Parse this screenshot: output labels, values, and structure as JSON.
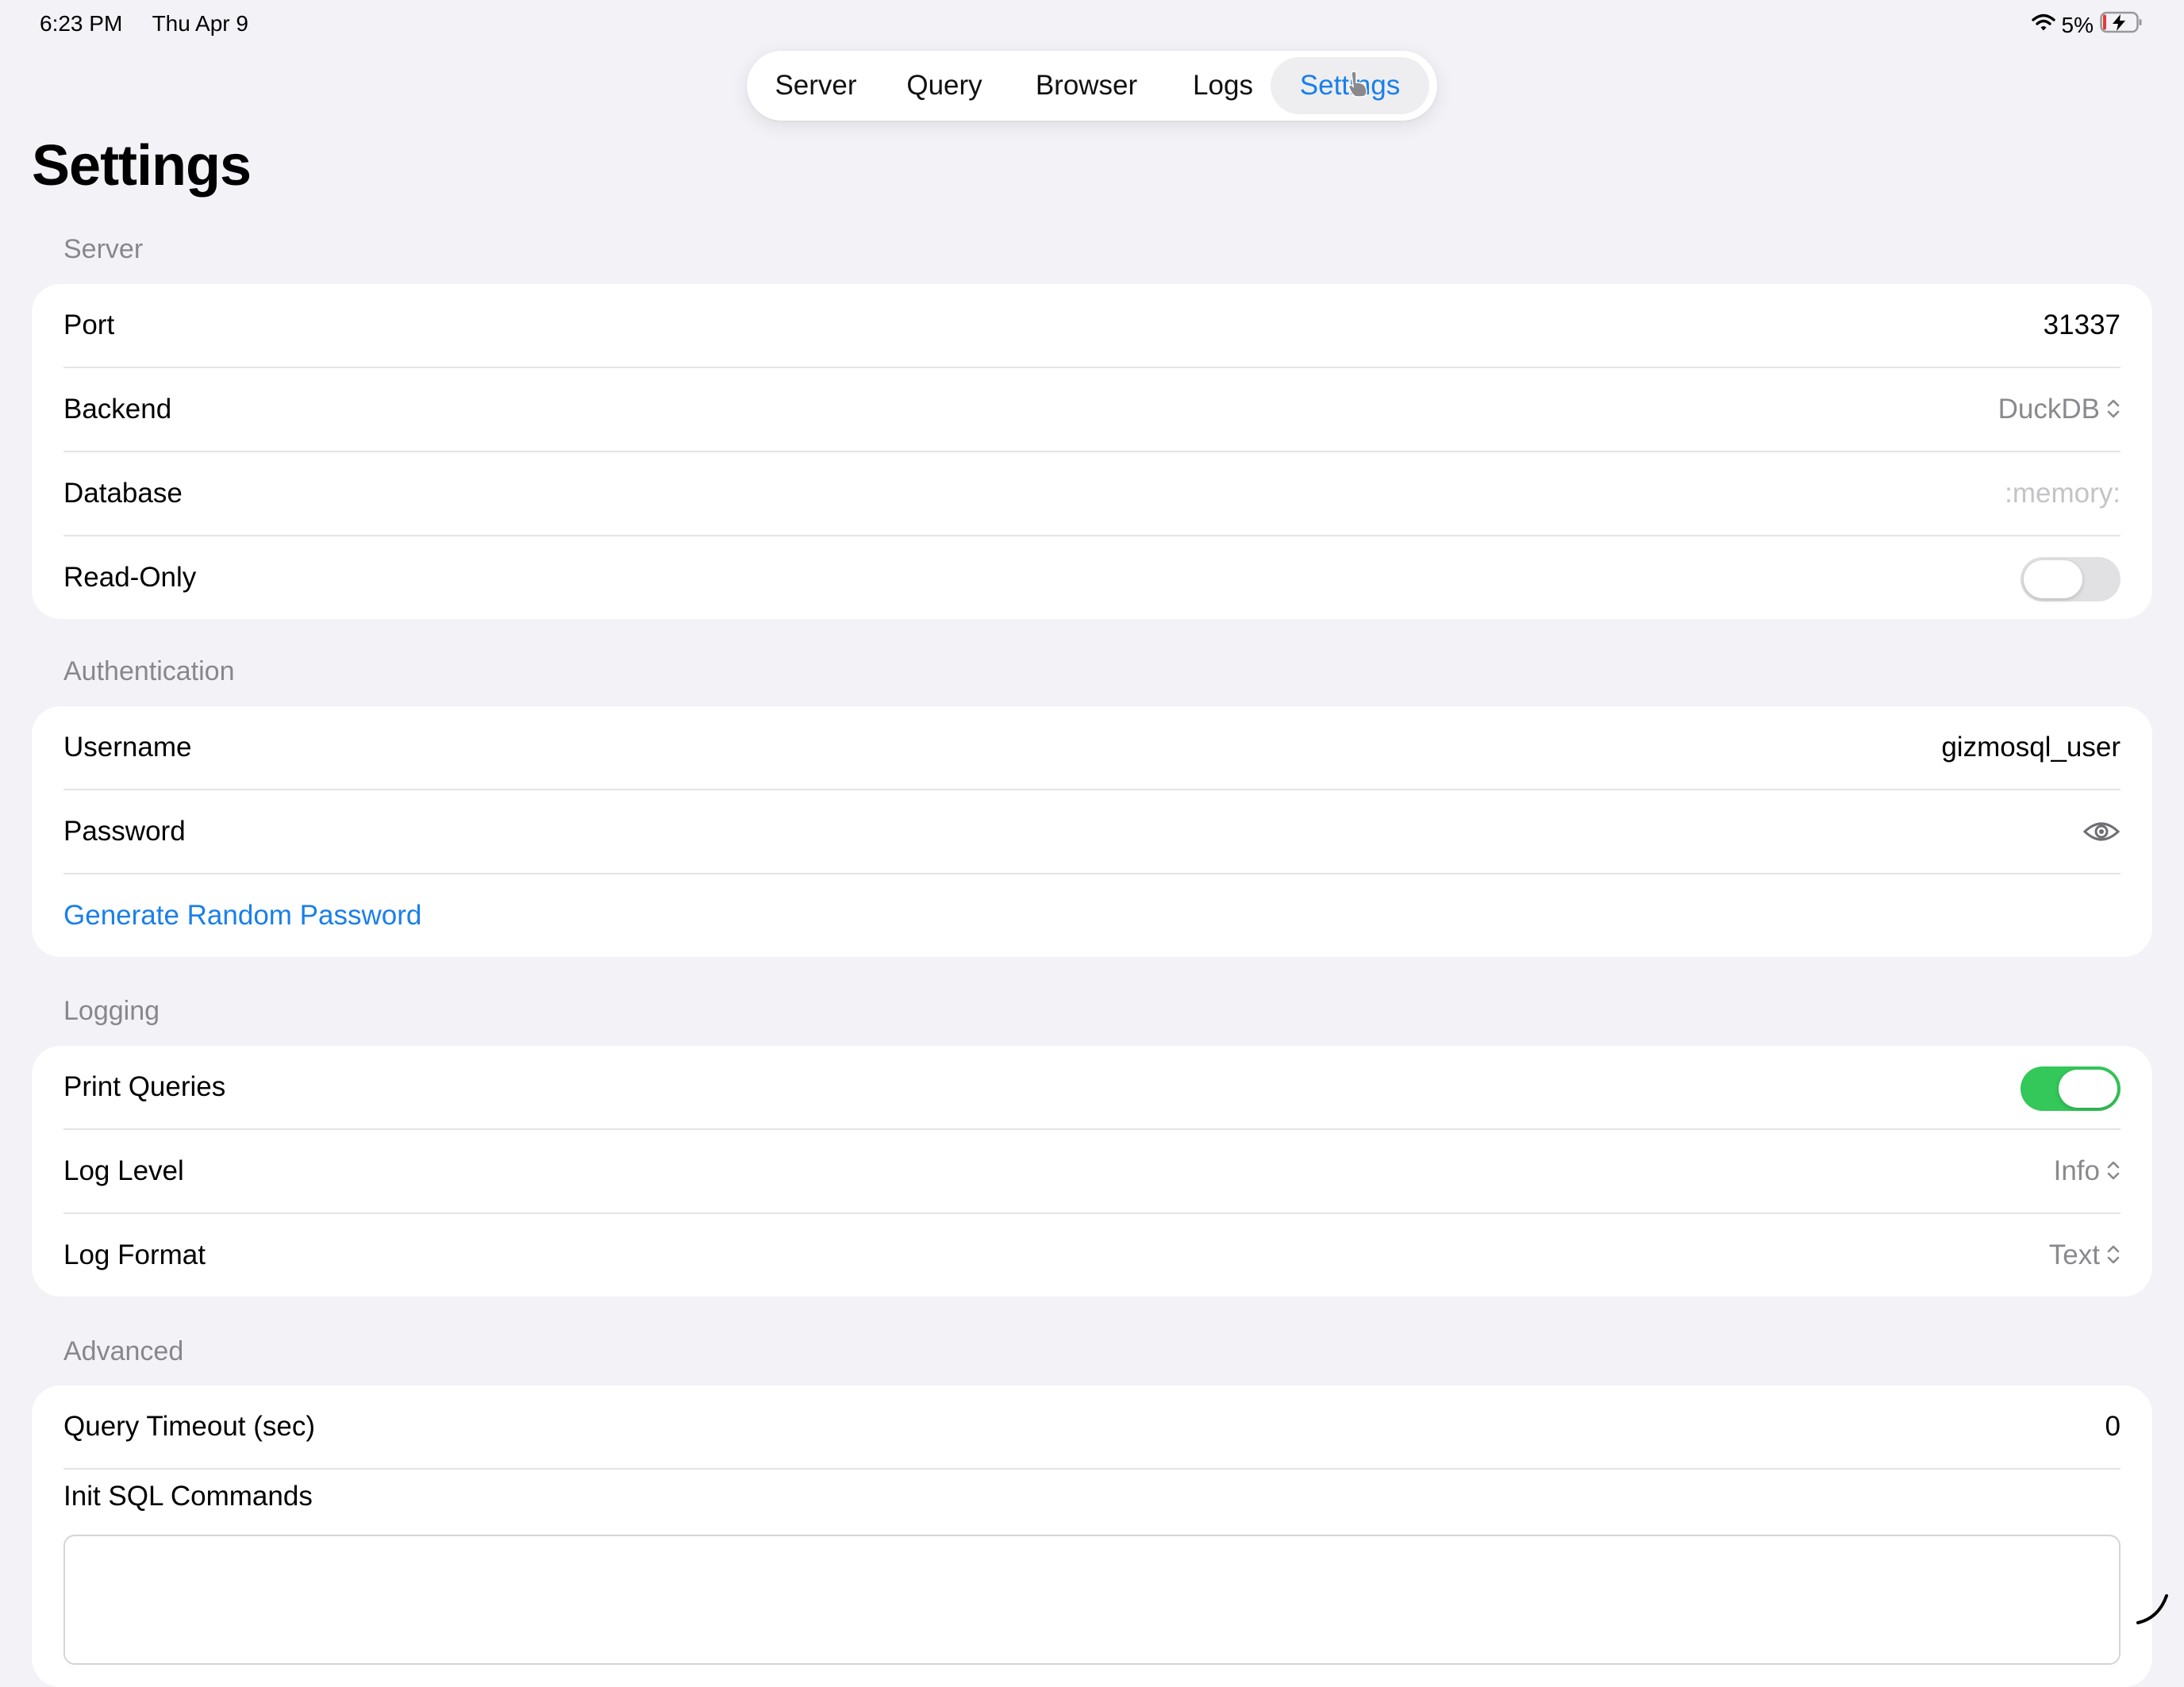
{
  "status_bar": {
    "time": "6:23 PM",
    "date": "Thu Apr 9",
    "battery": "5%"
  },
  "tabs": [
    {
      "label": "Server"
    },
    {
      "label": "Query"
    },
    {
      "label": "Browser"
    },
    {
      "label": "Logs"
    },
    {
      "label": "Settings",
      "active": true
    }
  ],
  "title": "Settings",
  "sections": {
    "server": {
      "header": "Server",
      "port_label": "Port",
      "port_value": "31337",
      "backend_label": "Backend",
      "backend_value": "DuckDB",
      "database_label": "Database",
      "database_placeholder": ":memory:",
      "readonly_label": "Read-Only",
      "readonly_on": false
    },
    "authentication": {
      "header": "Authentication",
      "username_label": "Username",
      "username_value": "gizmosql_user",
      "password_label": "Password",
      "generate_label": "Generate Random Password"
    },
    "logging": {
      "header": "Logging",
      "print_queries_label": "Print Queries",
      "print_queries_on": true,
      "log_level_label": "Log Level",
      "log_level_value": "Info",
      "log_format_label": "Log Format",
      "log_format_value": "Text"
    },
    "advanced": {
      "header": "Advanced",
      "timeout_label": "Query Timeout (sec)",
      "timeout_value": "0",
      "init_sql_label": "Init SQL Commands"
    }
  },
  "colors": {
    "accent": "#1a7fea",
    "toggle_on": "#34c759",
    "background": "#f2f2f7"
  },
  "icons": [
    "wifi-icon",
    "battery-charging-icon",
    "chevron-updown-icon",
    "eye-icon",
    "pointer-cursor-icon",
    "resize-corner-icon"
  ]
}
